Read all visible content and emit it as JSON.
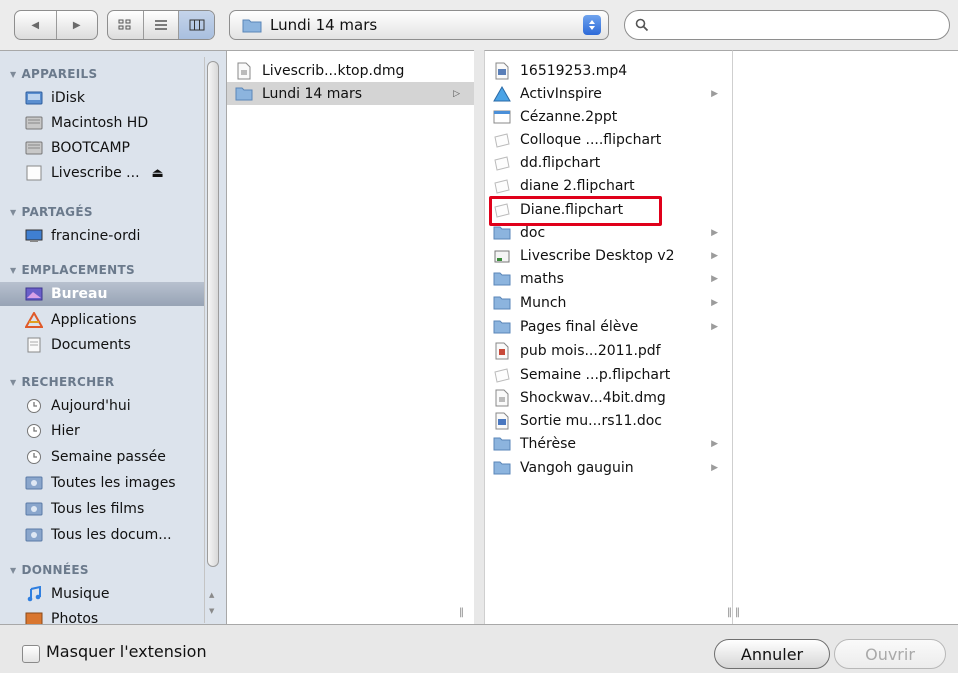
{
  "toolbar": {
    "path_label": "Lundi 14 mars"
  },
  "sidebar": {
    "sections": [
      {
        "title": "APPAREILS"
      },
      {
        "title": "PARTAGÉS"
      },
      {
        "title": "EMPLACEMENTS"
      },
      {
        "title": "RECHERCHER"
      },
      {
        "title": "DONNÉES"
      }
    ],
    "items": [
      {
        "label": "iDisk",
        "icon": "idisk-icon"
      },
      {
        "label": "Macintosh HD",
        "icon": "hard-drive-icon"
      },
      {
        "label": "BOOTCAMP",
        "icon": "hard-drive-icon"
      },
      {
        "label": "Livescribe ...",
        "icon": "removable-drive-icon"
      },
      {
        "label": "francine-ordi",
        "icon": "computer-icon"
      },
      {
        "label": "Bureau",
        "icon": "desktop-icon"
      },
      {
        "label": "Applications",
        "icon": "applications-icon"
      },
      {
        "label": "Documents",
        "icon": "documents-icon"
      },
      {
        "label": "Aujourd'hui",
        "icon": "clock-icon"
      },
      {
        "label": "Hier",
        "icon": "clock-icon"
      },
      {
        "label": "Semaine passée",
        "icon": "clock-icon"
      },
      {
        "label": "Toutes les images",
        "icon": "smart-folder-icon"
      },
      {
        "label": "Tous les films",
        "icon": "smart-folder-icon"
      },
      {
        "label": "Tous les docum...",
        "icon": "smart-folder-icon"
      },
      {
        "label": "Musique",
        "icon": "music-icon"
      },
      {
        "label": "Photos",
        "icon": "photos-icon"
      }
    ]
  },
  "column1": [
    {
      "label": "Livescrib...ktop.dmg",
      "icon": "dmg-file-icon"
    },
    {
      "label": "Lundi 14 mars",
      "icon": "folder-icon"
    }
  ],
  "column2": [
    {
      "label": "16519253.mp4",
      "icon": "video-file-icon"
    },
    {
      "label": "ActivInspire",
      "icon": "app-folder-icon"
    },
    {
      "label": "Cézanne.2ppt",
      "icon": "presentation-file-icon"
    },
    {
      "label": "Colloque ....flipchart",
      "icon": "flipchart-file-icon"
    },
    {
      "label": "dd.flipchart",
      "icon": "flipchart-file-icon"
    },
    {
      "label": "diane 2.flipchart",
      "icon": "flipchart-file-icon"
    },
    {
      "label": "Diane.flipchart",
      "icon": "flipchart-file-icon"
    },
    {
      "label": "doc",
      "icon": "folder-icon"
    },
    {
      "label": "Livescribe Desktop v2",
      "icon": "installer-icon"
    },
    {
      "label": "maths",
      "icon": "folder-icon"
    },
    {
      "label": "Munch",
      "icon": "folder-icon"
    },
    {
      "label": "Pages final élève",
      "icon": "folder-icon"
    },
    {
      "label": "pub mois...2011.pdf",
      "icon": "pdf-file-icon"
    },
    {
      "label": "Semaine ...p.flipchart",
      "icon": "flipchart-file-icon"
    },
    {
      "label": "Shockwav...4bit.dmg",
      "icon": "dmg-file-icon"
    },
    {
      "label": "Sortie mu...rs11.doc",
      "icon": "word-file-icon"
    },
    {
      "label": "Thérèse",
      "icon": "folder-icon"
    },
    {
      "label": "Vangoh gauguin",
      "icon": "folder-icon"
    }
  ],
  "footer": {
    "hide_extension_label": "Masquer l'extension",
    "cancel_label": "Annuler",
    "open_label": "Ouvrir"
  },
  "colors": {
    "sidebar_bg": "#dce3ec",
    "selection_red": "#e0001a",
    "folder_blue": "#7fa8d4"
  }
}
